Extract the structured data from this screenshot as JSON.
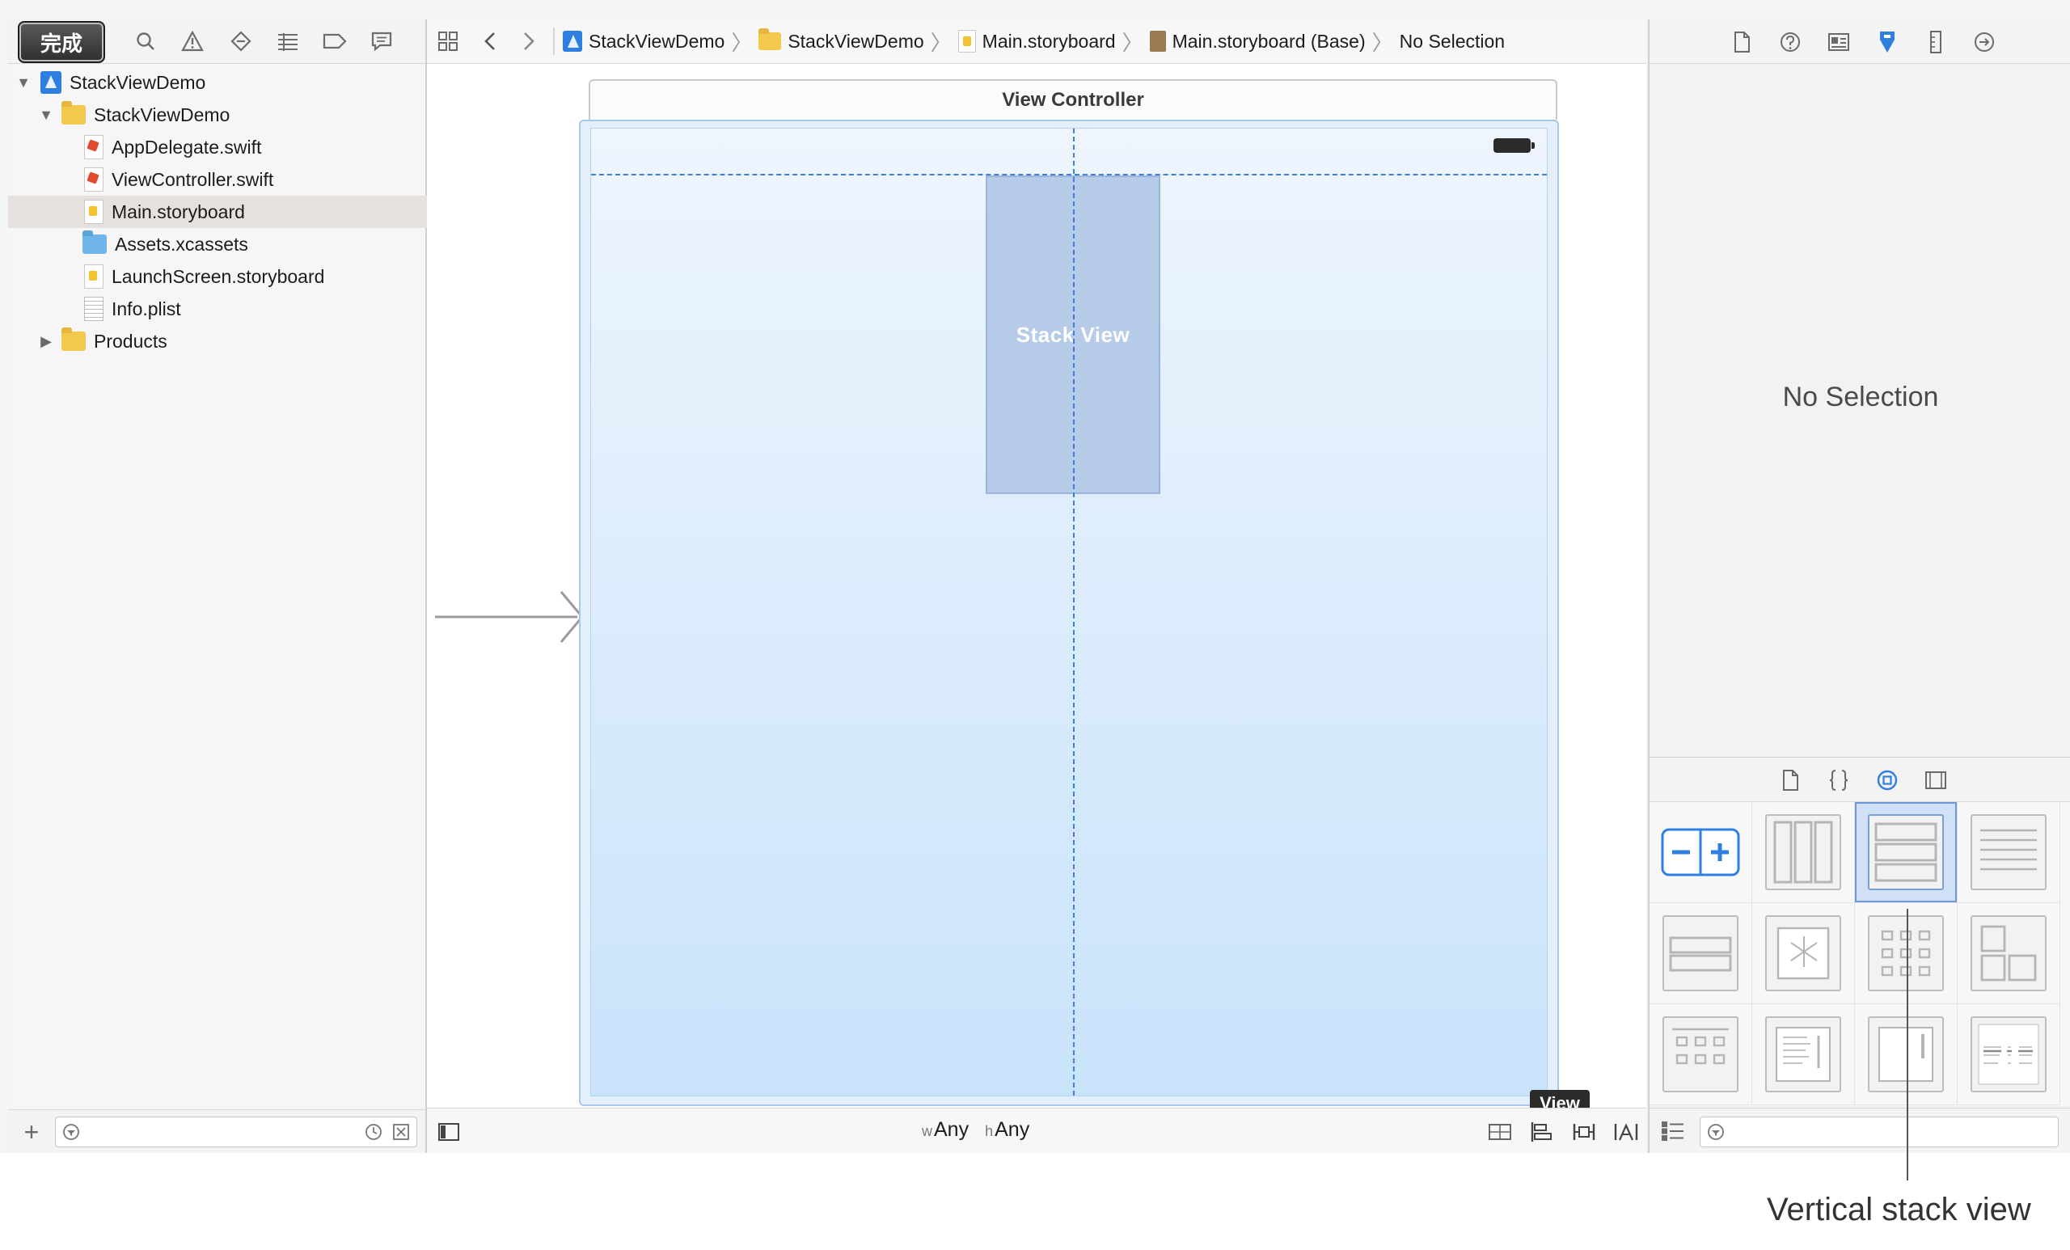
{
  "toolbar": {
    "done_label": "完成"
  },
  "navigator": {
    "tree": [
      {
        "label": "StackViewDemo",
        "icon": "project-icon",
        "disclosure": "expanded",
        "indent": 0
      },
      {
        "label": "StackViewDemo",
        "icon": "folder-icon",
        "disclosure": "expanded",
        "indent": 1
      },
      {
        "label": "AppDelegate.swift",
        "icon": "swift-file-icon",
        "indent": 2
      },
      {
        "label": "ViewController.swift",
        "icon": "swift-file-icon",
        "indent": 2
      },
      {
        "label": "Main.storyboard",
        "icon": "storyboard-file-icon",
        "indent": 2,
        "selected": true
      },
      {
        "label": "Assets.xcassets",
        "icon": "asset-catalog-icon",
        "indent": 2
      },
      {
        "label": "LaunchScreen.storyboard",
        "icon": "storyboard-file-icon",
        "indent": 2
      },
      {
        "label": "Info.plist",
        "icon": "plist-file-icon",
        "indent": 2
      },
      {
        "label": "Products",
        "icon": "folder-icon",
        "disclosure": "collapsed",
        "indent": 1
      }
    ]
  },
  "jumpbar": {
    "crumbs": [
      "StackViewDemo",
      "StackViewDemo",
      "Main.storyboard",
      "Main.storyboard (Base)",
      "No Selection"
    ]
  },
  "canvas": {
    "scene_title": "View Controller",
    "stack_view_label": "Stack View",
    "tooltip": "View"
  },
  "size_class": {
    "w_prefix": "w",
    "w_value": "Any",
    "h_prefix": "h",
    "h_value": "Any"
  },
  "inspector": {
    "placeholder": "No Selection"
  },
  "caption": {
    "text": "Vertical stack view"
  },
  "colors": {
    "accent": "#2f7fe0",
    "selection_row": "#e6e0de",
    "canvas_top": "#eef5fd",
    "canvas_bottom": "#c9e3fb"
  }
}
